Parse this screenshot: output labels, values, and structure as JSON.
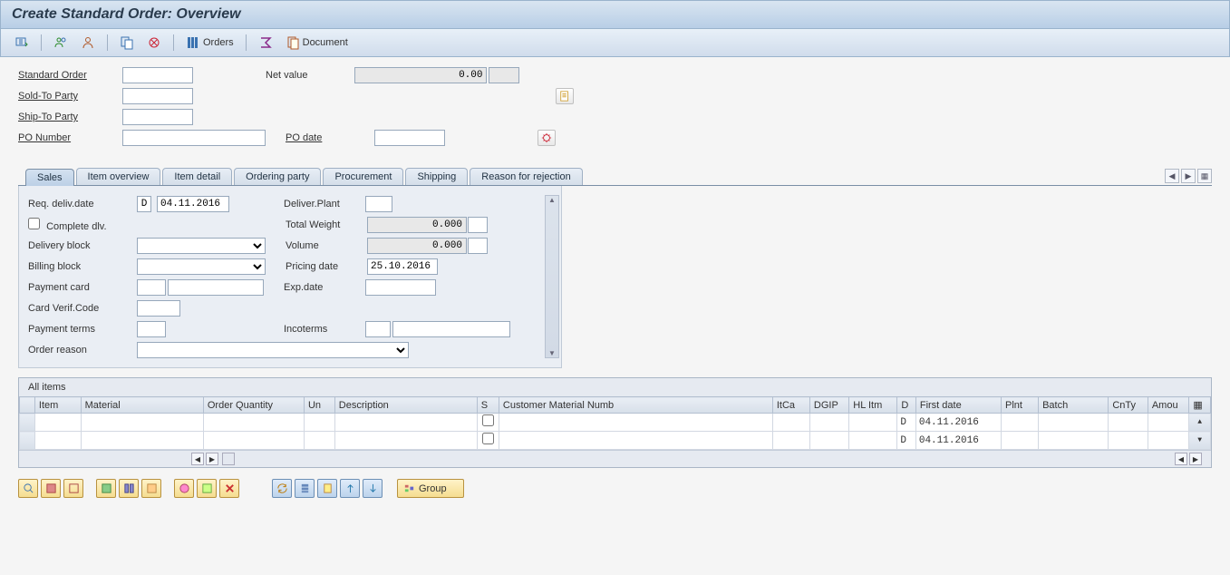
{
  "title": "Create Standard Order: Overview",
  "toolbar": {
    "orders_label": "Orders",
    "document_label": "Document"
  },
  "header": {
    "standard_order_label": "Standard Order",
    "net_value_label": "Net value",
    "net_value": "0.00",
    "sold_to_label": "Sold-To Party",
    "ship_to_label": "Ship-To Party",
    "po_number_label": "PO Number",
    "po_date_label": "PO date"
  },
  "tabs": {
    "sales": "Sales",
    "item_overview": "Item overview",
    "item_detail": "Item detail",
    "ordering_party": "Ordering party",
    "procurement": "Procurement",
    "shipping": "Shipping",
    "reason_rejection": "Reason for rejection"
  },
  "sales": {
    "req_deliv_date_label": "Req. deliv.date",
    "req_deliv_type": "D",
    "req_deliv_date": "04.11.2016",
    "deliver_plant_label": "Deliver.Plant",
    "complete_dlv_label": "Complete dlv.",
    "total_weight_label": "Total Weight",
    "total_weight": "0.000",
    "delivery_block_label": "Delivery block",
    "volume_label": "Volume",
    "volume": "0.000",
    "billing_block_label": "Billing block",
    "pricing_date_label": "Pricing date",
    "pricing_date": "25.10.2016",
    "payment_card_label": "Payment card",
    "exp_date_label": "Exp.date",
    "card_verif_label": "Card Verif.Code",
    "payment_terms_label": "Payment terms",
    "incoterms_label": "Incoterms",
    "order_reason_label": "Order reason"
  },
  "items_section": {
    "title": "All items",
    "columns": {
      "item": "Item",
      "material": "Material",
      "order_qty": "Order Quantity",
      "un": "Un",
      "description": "Description",
      "s": "S",
      "cust_mat": "Customer Material Numb",
      "itca": "ItCa",
      "dgip": "DGIP",
      "hlitm": "HL Itm",
      "d": "D",
      "first_date": "First date",
      "plnt": "Plnt",
      "batch": "Batch",
      "cnty": "CnTy",
      "amount": "Amou"
    },
    "rows": [
      {
        "d": "D",
        "first_date": "04.11.2016"
      },
      {
        "d": "D",
        "first_date": "04.11.2016"
      }
    ]
  },
  "bottom_bar": {
    "group_label": "Group"
  }
}
